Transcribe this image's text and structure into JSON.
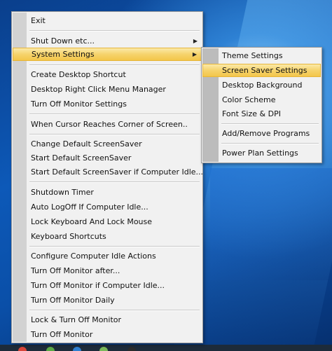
{
  "main_menu": {
    "items": [
      {
        "label": "Exit"
      },
      {
        "label": "Shut Down etc..."
      },
      {
        "label": "System Settings"
      },
      {
        "label": "Create Desktop Shortcut"
      },
      {
        "label": "Desktop Right Click Menu Manager"
      },
      {
        "label": "Turn Off Monitor Settings"
      },
      {
        "label": "When Cursor Reaches Corner of Screen.."
      },
      {
        "label": "Change Default ScreenSaver"
      },
      {
        "label": "Start Default ScreenSaver"
      },
      {
        "label": "Start Default ScreenSaver if Computer Idle..."
      },
      {
        "label": "Shutdown Timer"
      },
      {
        "label": "Auto LogOff If Computer Idle..."
      },
      {
        "label": "Lock Keyboard And Lock Mouse"
      },
      {
        "label": "Keyboard Shortcuts"
      },
      {
        "label": "Configure Computer Idle Actions"
      },
      {
        "label": "Turn Off Monitor after..."
      },
      {
        "label": "Turn Off Monitor if Computer Idle..."
      },
      {
        "label": "Turn Off Monitor Daily"
      },
      {
        "label": "Lock & Turn Off Monitor"
      },
      {
        "label": "Turn Off Monitor"
      }
    ]
  },
  "sub_menu": {
    "items": [
      {
        "label": "Theme Settings"
      },
      {
        "label": "Screen Saver Settings"
      },
      {
        "label": "Desktop Background"
      },
      {
        "label": "Color Scheme"
      },
      {
        "label": "Font Size & DPI"
      },
      {
        "label": "Add/Remove Programs"
      },
      {
        "label": "Power Plan Settings"
      }
    ]
  },
  "icons": {
    "submenu_arrow": "right-triangle-icon"
  },
  "colors": {
    "highlight": "#f6d36c",
    "menu_bg": "#f1f1f1",
    "desktop": "#0d59b8"
  }
}
